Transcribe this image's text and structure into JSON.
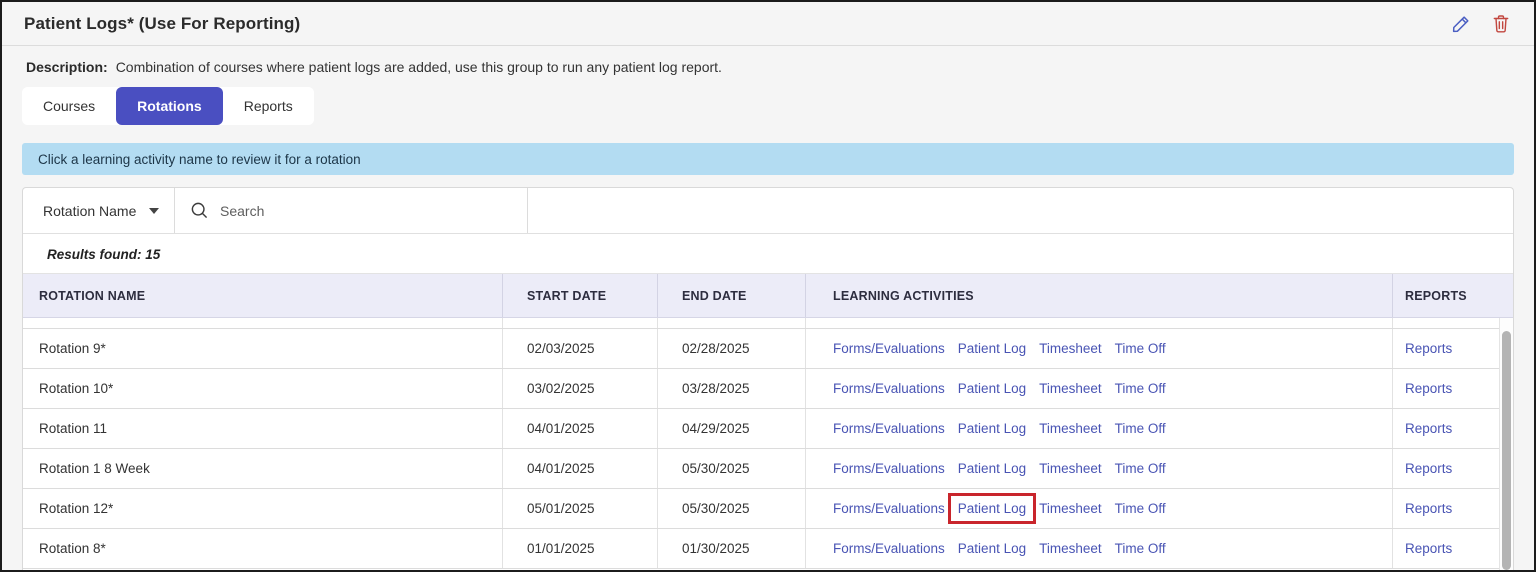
{
  "title": "Patient Logs* (Use For Reporting)",
  "description": {
    "label": "Description:",
    "text": "Combination of courses where patient logs are added, use this group to run any patient log report."
  },
  "tabs": [
    {
      "label": "Courses",
      "active": false
    },
    {
      "label": "Rotations",
      "active": true
    },
    {
      "label": "Reports",
      "active": false
    }
  ],
  "banner_text": "Click a learning activity name to review it for a rotation",
  "search": {
    "filter_selected": "Rotation Name",
    "placeholder": "Search"
  },
  "results": {
    "label": "Results found:",
    "count": "15"
  },
  "icons": {
    "edit": "pencil-icon",
    "delete": "trash-icon",
    "search": "magnifier-icon",
    "filter": "chevron-down-icon"
  },
  "table": {
    "columns": [
      "ROTATION NAME",
      "START DATE",
      "END DATE",
      "LEARNING ACTIVITIES",
      "REPORTS"
    ],
    "rows": [
      {
        "name": "Rotation 9*",
        "start": "02/03/2025",
        "end": "02/28/2025",
        "activities": [
          "Forms/Evaluations",
          "Patient Log",
          "Timesheet",
          "Time Off"
        ],
        "report": "Reports",
        "highlighted_activity": null
      },
      {
        "name": "Rotation 10*",
        "start": "03/02/2025",
        "end": "03/28/2025",
        "activities": [
          "Forms/Evaluations",
          "Patient Log",
          "Timesheet",
          "Time Off"
        ],
        "report": "Reports",
        "highlighted_activity": null
      },
      {
        "name": "Rotation 11",
        "start": "04/01/2025",
        "end": "04/29/2025",
        "activities": [
          "Forms/Evaluations",
          "Patient Log",
          "Timesheet",
          "Time Off"
        ],
        "report": "Reports",
        "highlighted_activity": null
      },
      {
        "name": "Rotation 1 8 Week",
        "start": "04/01/2025",
        "end": "05/30/2025",
        "activities": [
          "Forms/Evaluations",
          "Patient Log",
          "Timesheet",
          "Time Off"
        ],
        "report": "Reports",
        "highlighted_activity": null
      },
      {
        "name": "Rotation 12*",
        "start": "05/01/2025",
        "end": "05/30/2025",
        "activities": [
          "Forms/Evaluations",
          "Patient Log",
          "Timesheet",
          "Time Off"
        ],
        "report": "Reports",
        "highlighted_activity": "Patient Log"
      },
      {
        "name": "Rotation 8*",
        "start": "01/01/2025",
        "end": "01/30/2025",
        "activities": [
          "Forms/Evaluations",
          "Patient Log",
          "Timesheet",
          "Time Off"
        ],
        "report": "Reports",
        "highlighted_activity": null
      }
    ]
  },
  "colors": {
    "accent": "#4a4fc1",
    "link": "#4954b4",
    "bannerBg": "#b3dcf2",
    "tableHeaderBg": "#ececf8",
    "highlight": "#c9252c",
    "danger": "#c2473f",
    "editIcon": "#4a5ec2"
  }
}
